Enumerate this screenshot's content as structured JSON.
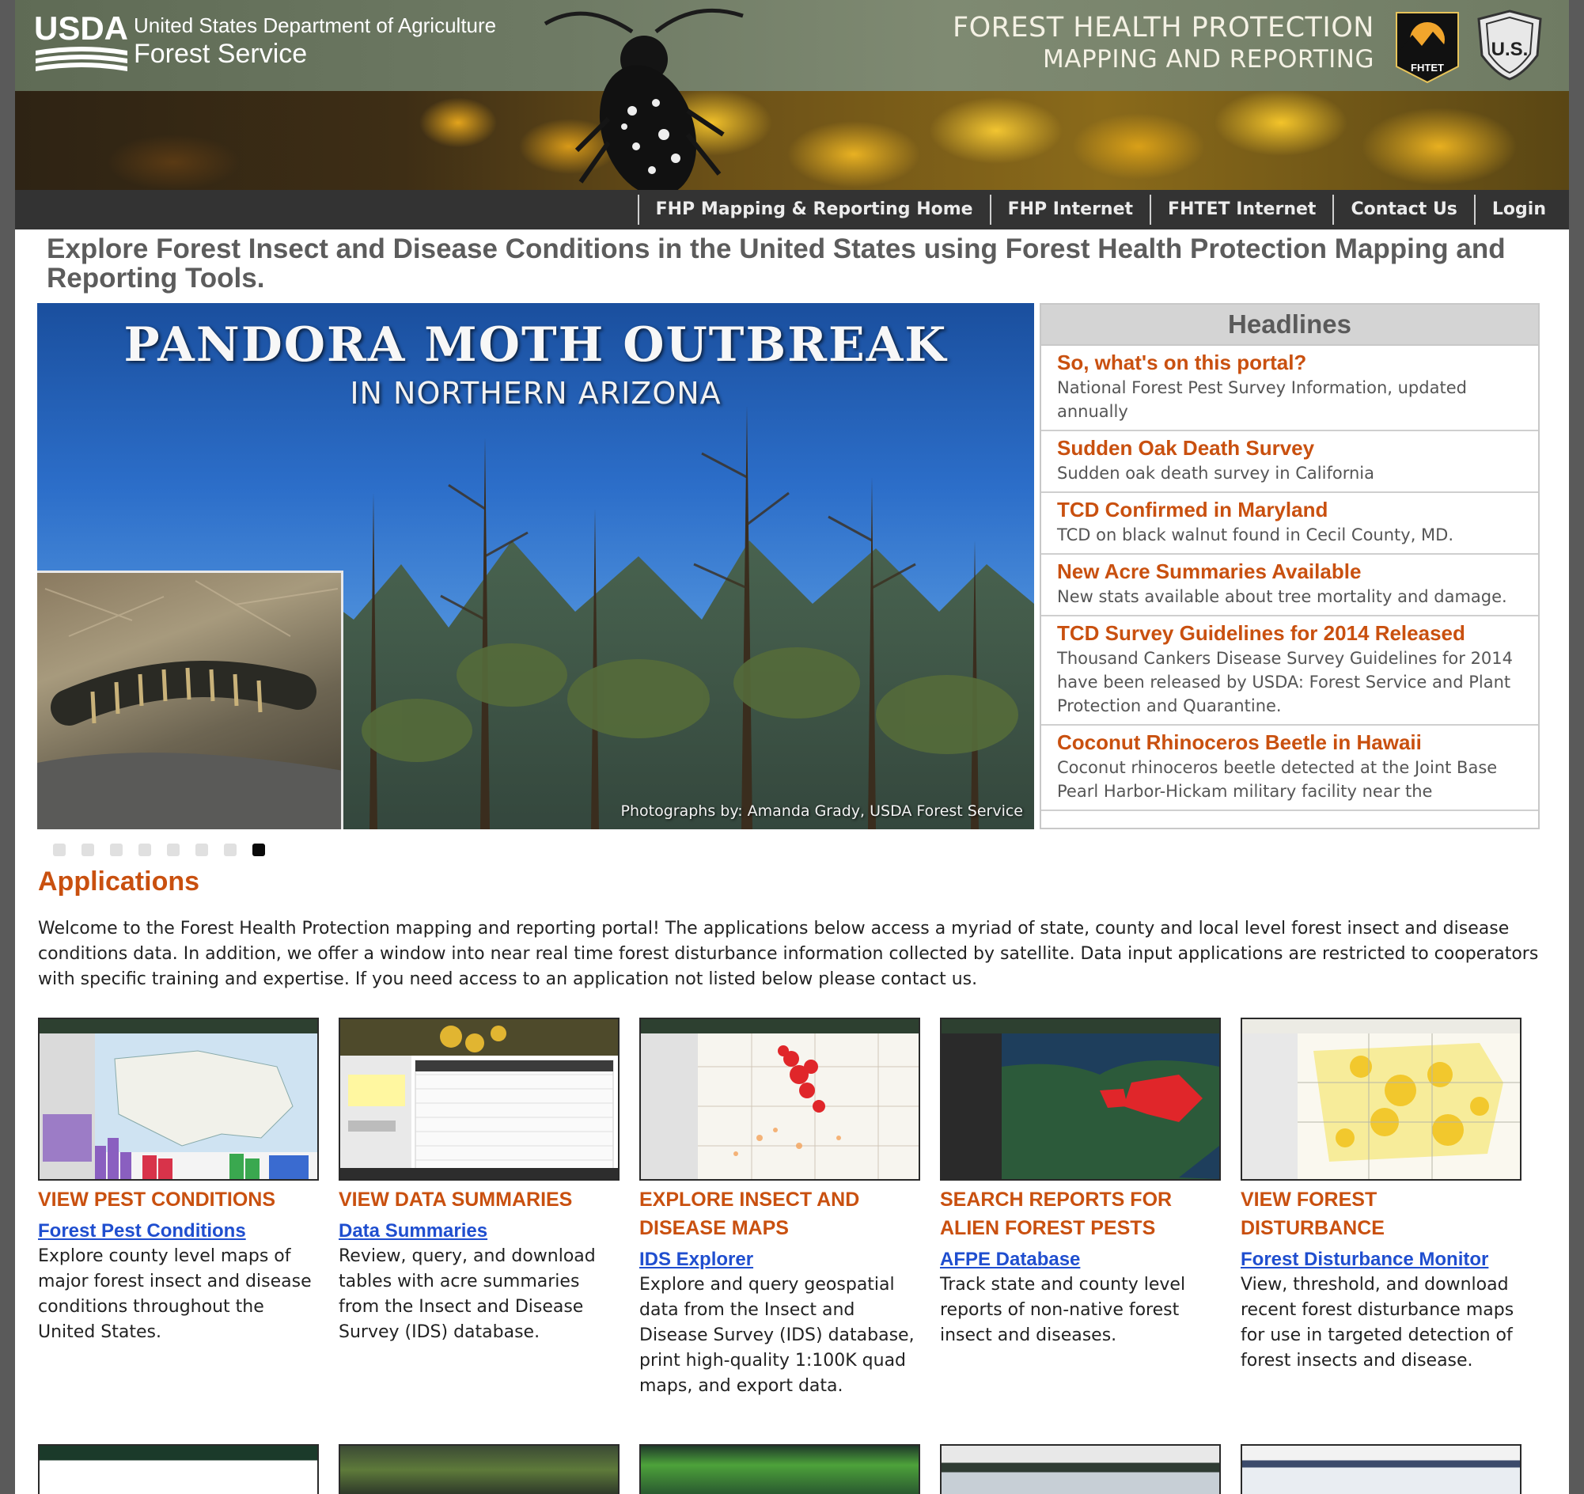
{
  "header": {
    "usda_logo_text": "USDA",
    "agency_line1": "United States Department of Agriculture",
    "agency_line2": "Forest Service",
    "title_line1": "FOREST HEALTH PROTECTION",
    "title_line2": "MAPPING AND REPORTING",
    "fhtet_badge_text": "FHTET",
    "fs_badge_text": "U.S."
  },
  "nav": {
    "items": [
      {
        "label": "FHP Mapping & Reporting Home"
      },
      {
        "label": "FHP Internet"
      },
      {
        "label": "FHTET Internet"
      },
      {
        "label": "Contact Us"
      },
      {
        "label": "Login"
      }
    ]
  },
  "main_heading": "Explore Forest Insect and Disease Conditions in the United States using Forest Health Protection Mapping and Reporting Tools.",
  "hero": {
    "title": "PANDORA MOTH OUTBREAK",
    "subtitle": "IN NORTHERN ARIZONA",
    "credit": "Photographs by: Amanda Grady, USDA Forest Service"
  },
  "headlines": {
    "title": "Headlines",
    "items": [
      {
        "title": "So, what's on this portal?",
        "desc": "National Forest Pest Survey Information, updated annually"
      },
      {
        "title": "Sudden Oak Death Survey",
        "desc": "Sudden oak death survey in California"
      },
      {
        "title": "TCD Confirmed in Maryland",
        "desc": "TCD on black walnut found in Cecil County, MD."
      },
      {
        "title": "New Acre Summaries Available",
        "desc": "New stats available about tree mortality and damage."
      },
      {
        "title": "TCD Survey Guidelines for 2014 Released",
        "desc": "Thousand Cankers Disease Survey Guidelines for 2014 have been released by USDA: Forest Service and Plant Protection and Quarantine."
      },
      {
        "title": "Coconut Rhinoceros Beetle in Hawaii",
        "desc": "Coconut rhinoceros beetle detected at the Joint Base Pearl Harbor-Hickam military facility near the"
      }
    ]
  },
  "slider": {
    "total": 8,
    "active_index": 7
  },
  "applications": {
    "heading": "Applications",
    "intro": "Welcome to the Forest Health Protection mapping and reporting portal! The applications below access a myriad of state, county and local level forest insect and disease conditions data. In addition, we offer a window into near real time forest disturbance information collected by satellite. Data input applications are restricted to cooperators with specific training and expertise. If you need access to an application not listed below please contact us.",
    "cards": [
      {
        "category": "VIEW PEST CONDITIONS",
        "link": "Forest Pest Conditions",
        "desc": "Explore county level maps of major forest insect and disease conditions throughout the United States."
      },
      {
        "category": "VIEW DATA SUMMARIES",
        "link": "Data Summaries",
        "desc": "Review, query, and download tables with acre summaries from the Insect and Disease Survey (IDS) database."
      },
      {
        "category": "EXPLORE INSECT AND DISEASE MAPS",
        "link": "IDS Explorer",
        "desc": "Explore and query geospatial data from the Insect and Disease Survey (IDS) database, print high-quality 1:100K quad maps, and export data."
      },
      {
        "category": "SEARCH REPORTS FOR ALIEN FOREST PESTS",
        "link": "AFPE Database",
        "desc": "Track state and county level reports of non-native forest insect and diseases."
      },
      {
        "category": "VIEW FOREST DISTURBANCE",
        "link": "Forest Disturbance Monitor",
        "desc": "View, threshold, and download recent forest disturbance maps for use in targeted detection of forest insects and disease."
      }
    ]
  },
  "colors": {
    "accent_orange": "#c9500f",
    "link_blue": "#1f4ecf",
    "nav_bg": "#333333",
    "page_bg": "#5a5a5a"
  }
}
